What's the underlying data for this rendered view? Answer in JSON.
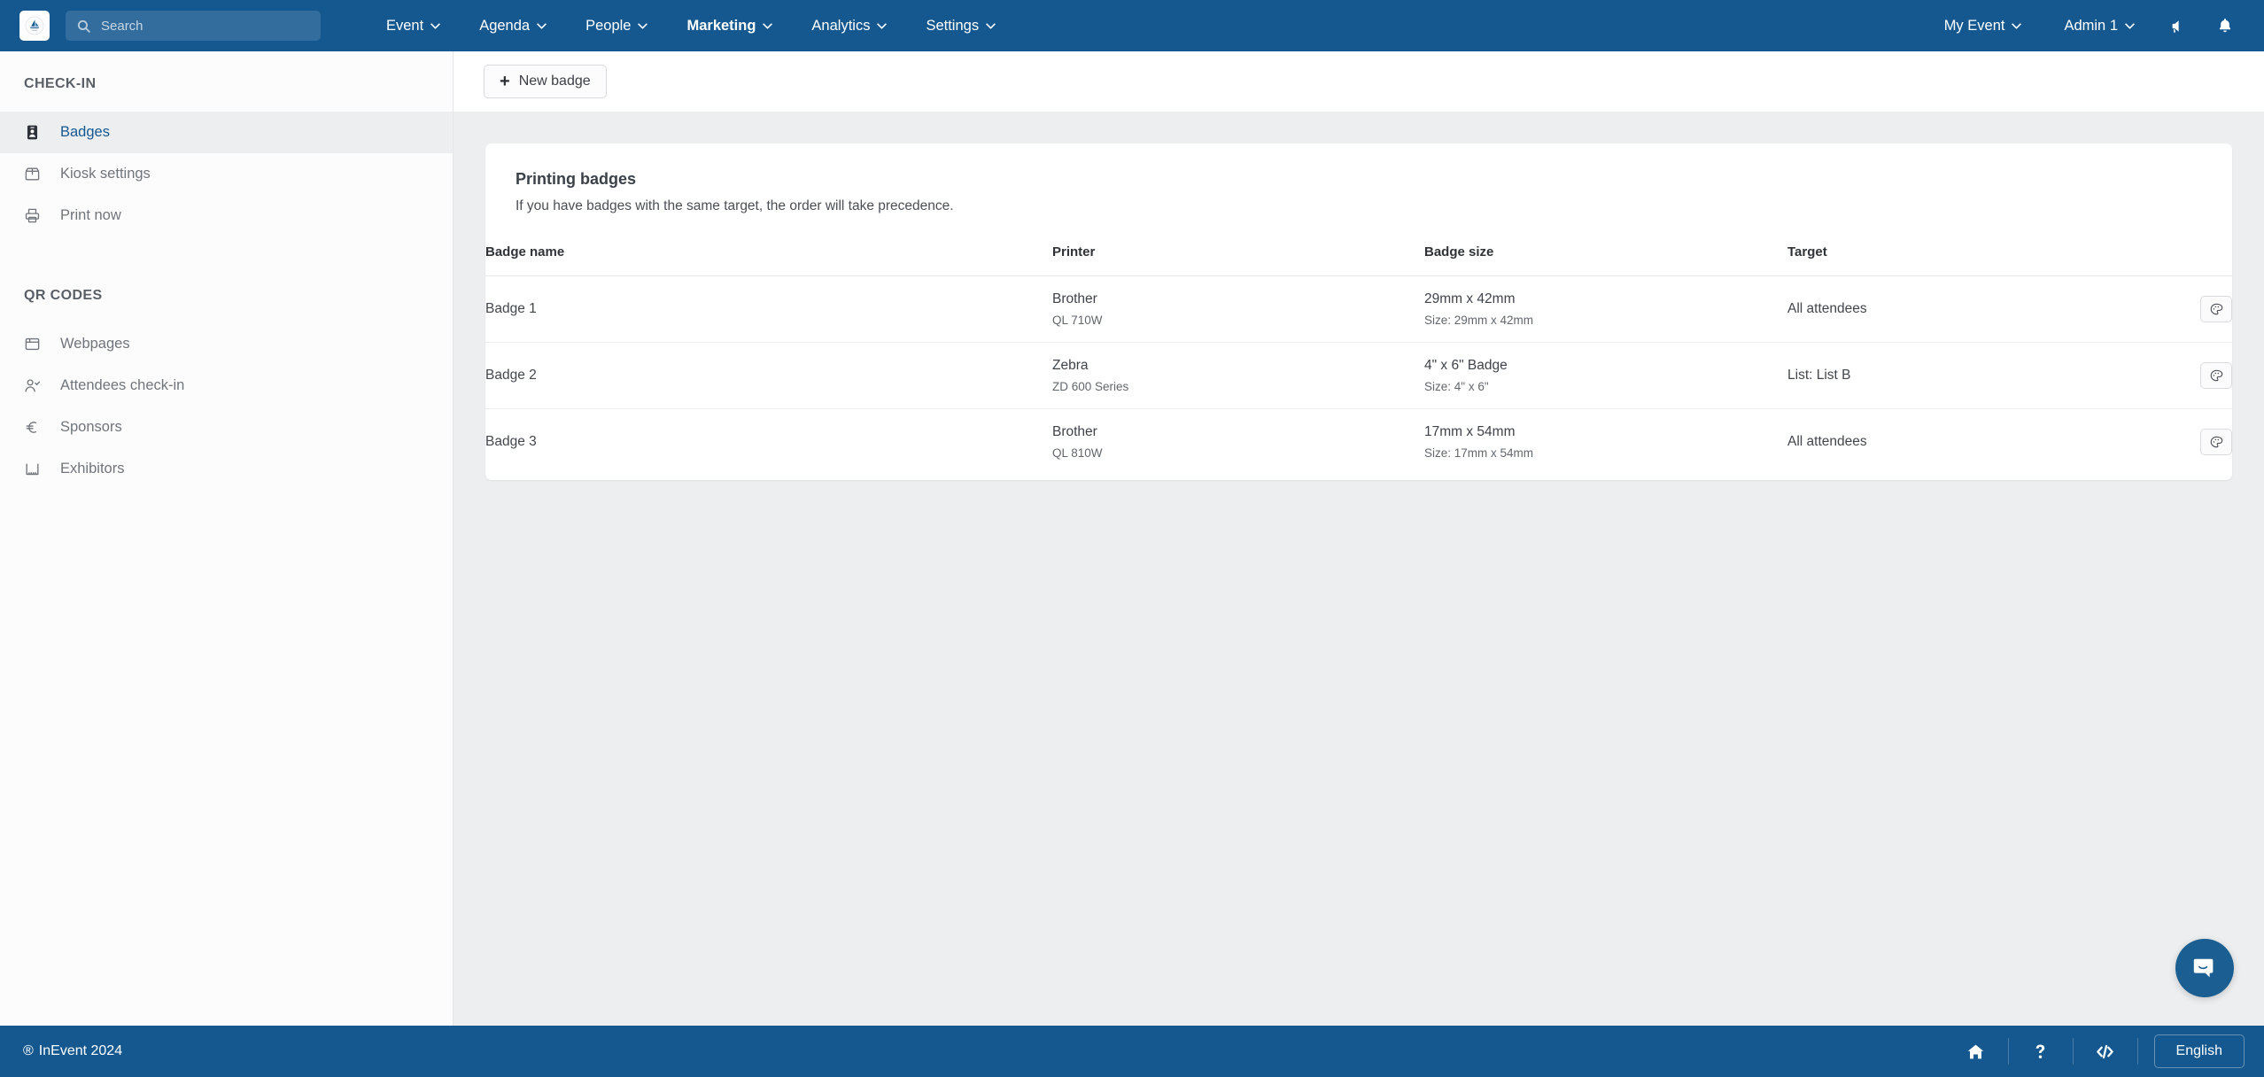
{
  "topnav": {
    "logo_icon": "inevent-logo-icon",
    "search": {
      "value": "",
      "placeholder": "Search",
      "icon": "search-icon"
    },
    "menu": [
      {
        "label": "Event",
        "active": false
      },
      {
        "label": "Agenda",
        "active": false
      },
      {
        "label": "People",
        "active": false
      },
      {
        "label": "Marketing",
        "active": true
      },
      {
        "label": "Analytics",
        "active": false
      },
      {
        "label": "Settings",
        "active": false
      }
    ],
    "event_selector": "My Event",
    "user_selector": "Admin 1",
    "announcement_icon": "megaphone-icon",
    "notifications_icon": "bell-icon"
  },
  "sidebar": {
    "groups": [
      {
        "title": "CHECK-IN",
        "items": [
          {
            "label": "Badges",
            "icon": "badge-id-card-icon",
            "active": true
          },
          {
            "label": "Kiosk settings",
            "icon": "kiosk-box-icon",
            "active": false
          },
          {
            "label": "Print now",
            "icon": "printer-icon",
            "active": false
          }
        ]
      },
      {
        "title": "QR CODES",
        "items": [
          {
            "label": "Webpages",
            "icon": "browser-window-icon",
            "active": false
          },
          {
            "label": "Attendees check-in",
            "icon": "user-check-icon",
            "active": false
          },
          {
            "label": "Sponsors",
            "icon": "euro-currency-icon",
            "active": false
          },
          {
            "label": "Exhibitors",
            "icon": "booth-icon",
            "active": false
          }
        ]
      }
    ]
  },
  "toolbar": {
    "new_badge_label": "New badge",
    "new_badge_icon": "plus-icon"
  },
  "card": {
    "title": "Printing badges",
    "subtitle": "If you have badges with the same target, the order will take precedence.",
    "columns": [
      "Badge name",
      "Printer",
      "Badge size",
      "Target",
      ""
    ],
    "rows": [
      {
        "name": "Badge 1",
        "printer_brand": "Brother",
        "printer_model": "QL 710W",
        "size_name": "29mm x 42mm",
        "size_detail": "Size: 29mm x 42mm",
        "target": "All attendees",
        "action_icon": "palette-icon"
      },
      {
        "name": "Badge 2",
        "printer_brand": "Zebra",
        "printer_model": "ZD 600 Series",
        "size_name": "4\" x 6\" Badge",
        "size_detail": "Size: 4\" x 6\"",
        "target": "List: List B",
        "action_icon": "palette-icon"
      },
      {
        "name": "Badge 3",
        "printer_brand": "Brother",
        "printer_model": "QL 810W",
        "size_name": "17mm x 54mm",
        "size_detail": "Size: 17mm x 54mm",
        "target": "All attendees",
        "action_icon": "palette-icon"
      }
    ]
  },
  "footer": {
    "copyright": "InEvent 2024",
    "registered_mark": "®",
    "home_icon": "home-icon",
    "help_icon": "question-mark-icon",
    "developer_icon": "code-brackets-icon",
    "language": "English"
  },
  "chat": {
    "icon": "chat-bubble-icon"
  },
  "colors": {
    "brand": "#15588f",
    "accent": "#15588f",
    "surface": "#eceef0"
  }
}
